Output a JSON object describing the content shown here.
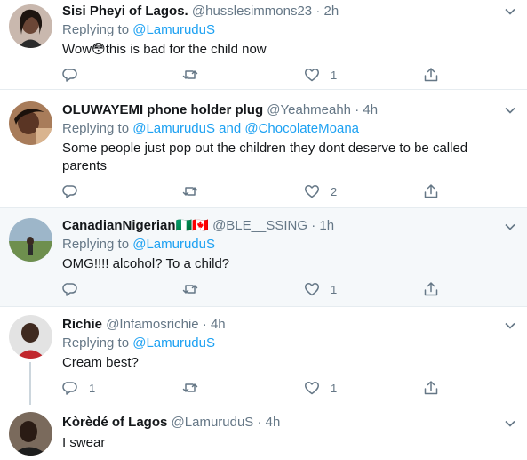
{
  "tweets": [
    {
      "name": "Sisi Pheyi of Lagos.",
      "handle": "@husslesimmons23",
      "time": "2h",
      "replying_label": "Replying to",
      "replying_to": "@LamuruduS",
      "replying_and": "",
      "replying_to2": "",
      "text": "Wow😳this is bad for the child now",
      "reply_count": "",
      "retweet_count": "",
      "like_count": "1"
    },
    {
      "name": "OLUWAYEMI phone holder plug",
      "handle": "@Yeahmeahh",
      "time": "4h",
      "replying_label": "Replying to",
      "replying_to": "@LamuruduS",
      "replying_and": "and",
      "replying_to2": "@ChocolateMoana",
      "text": "Some people just pop out the children they dont deserve to be called parents",
      "reply_count": "",
      "retweet_count": "",
      "like_count": "2"
    },
    {
      "name": "CanadianNigerian",
      "flags": "🇳🇬🇨🇦",
      "handle": "@BLE__SSING",
      "time": "1h",
      "replying_label": "Replying to",
      "replying_to": "@LamuruduS",
      "replying_and": "",
      "replying_to2": "",
      "text": "OMG!!!! alcohol? To a child?",
      "reply_count": "",
      "retweet_count": "",
      "like_count": "1"
    },
    {
      "name": "Richie",
      "handle": "@Infamosrichie",
      "time": "4h",
      "replying_label": "Replying to",
      "replying_to": "@LamuruduS",
      "replying_and": "",
      "replying_to2": "",
      "text": "Cream best?",
      "reply_count": "1",
      "retweet_count": "",
      "like_count": "1"
    },
    {
      "name": "Kòrèdé of Lagos",
      "handle": "@LamuruduS",
      "time": "4h",
      "text": "I swear"
    }
  ],
  "separator": "·",
  "icons": {
    "reply": "reply-icon",
    "retweet": "retweet-icon",
    "like": "heart-icon",
    "share": "share-icon",
    "menu": "chevron-down-icon"
  },
  "colors": {
    "link": "#1da1f2",
    "muted": "#657786",
    "highlight_bg": "#f5f8fa",
    "border": "#e6ecf0"
  }
}
